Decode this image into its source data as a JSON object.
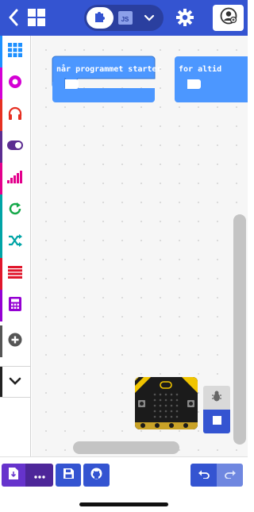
{
  "header": {
    "back_icon": "chevron-left-icon",
    "home_icon": "grid-home-icon",
    "blocks_icon": "puzzle-icon",
    "javascript_label": "JS",
    "language_dropdown_icon": "chevron-down-icon",
    "settings_icon": "gear-icon",
    "user_icon": "user-circle-icon"
  },
  "toolbox": {
    "categories": [
      {
        "icon": "grid-icon",
        "color": "#1e90ff"
      },
      {
        "icon": "circle-dot-icon",
        "color": "#d400d4"
      },
      {
        "icon": "headphones-icon",
        "color": "#e63022"
      },
      {
        "icon": "toggle-icon",
        "color": "#5c2d91"
      },
      {
        "icon": "signal-bars-icon",
        "color": "#e3008c"
      },
      {
        "icon": "refresh-icon",
        "color": "#00a4a6"
      },
      {
        "icon": "shuffle-icon",
        "color": "#00a4a6"
      },
      {
        "icon": "list-icon",
        "color": "#e0162b"
      },
      {
        "icon": "calculator-icon",
        "color": "#9400d3"
      },
      {
        "icon": "plus-circle-icon",
        "color": "#555555"
      }
    ],
    "more_icon": "chevron-down-icon"
  },
  "workspace": {
    "blocks": [
      {
        "label": "når programmet starter",
        "color": "#4c97ff"
      },
      {
        "label": "for altid",
        "color": "#4c97ff"
      }
    ]
  },
  "simulator": {
    "debug_icon": "bug-icon",
    "stop_icon": "stop-square-icon"
  },
  "footer": {
    "download_icon": "download-file-icon",
    "more_icon": "ellipsis-icon",
    "save_icon": "floppy-disk-icon",
    "github_icon": "github-icon",
    "undo_icon": "undo-icon",
    "redo_icon": "redo-icon"
  },
  "colors": {
    "primary": "#3454d1",
    "header_pill": "#2a3f9f",
    "download": "#6633cc",
    "block": "#4c97ff"
  }
}
